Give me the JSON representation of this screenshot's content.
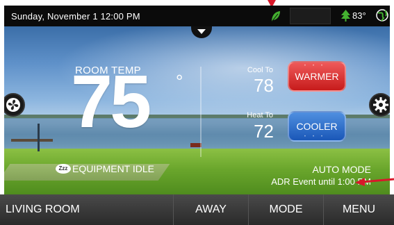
{
  "status_bar": {
    "datetime": "Sunday, November 1  12:00 PM",
    "outdoor_temp": "83°",
    "icons": [
      "leaf-icon",
      "tree-icon",
      "globe-icon"
    ]
  },
  "main": {
    "room_temp_label": "ROOM TEMP",
    "room_temp_value": "75",
    "degree_symbol": "°",
    "cool_to_label": "Cool To",
    "cool_to_value": "78",
    "heat_to_label": "Heat To",
    "heat_to_value": "72",
    "warmer_label": "WARMER",
    "cooler_label": "COOLER",
    "equipment_status": "EQUIPMENT IDLE",
    "zzz_badge": "Zzz",
    "mode_status": "AUTO MODE",
    "adr_event": "ADR Event until 1:00 PM"
  },
  "nav": {
    "room": "LIVING ROOM",
    "away": "AWAY",
    "mode": "MODE",
    "menu": "MENU"
  },
  "colors": {
    "warmer": "#d62b2b",
    "cooler": "#2a6fd1",
    "leaf": "#44b030",
    "arrow": "#d8182a"
  }
}
